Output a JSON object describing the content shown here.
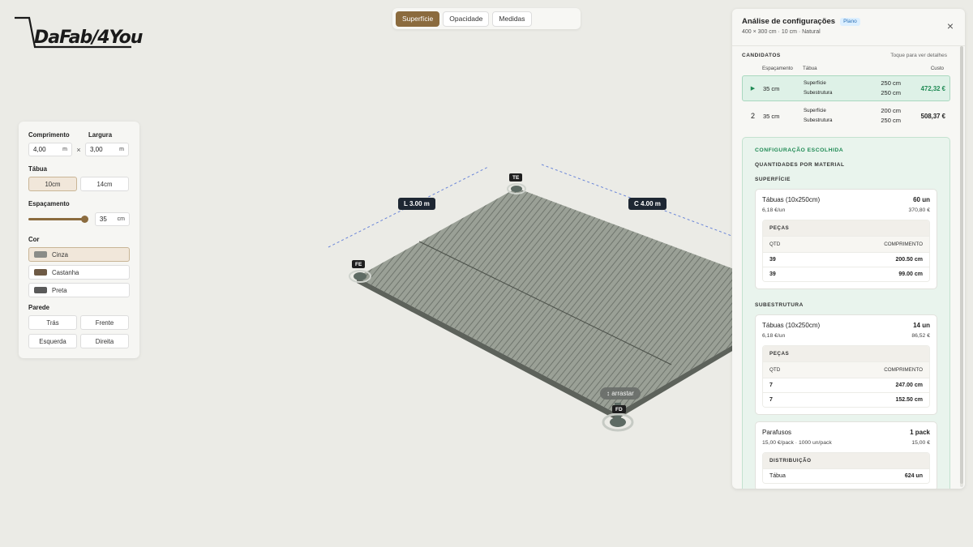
{
  "logo": {
    "text": "DaFab/4You"
  },
  "topbar": {
    "tabs": [
      "Superfície",
      "Opacidade",
      "Medidas"
    ],
    "active": "Superfície"
  },
  "left": {
    "length_label": "Comprimento",
    "length_value": "4,00",
    "length_unit": "m",
    "times": "×",
    "width_label": "Largura",
    "width_value": "3,00",
    "width_unit": "m",
    "board_label": "Tábua",
    "board_opt1": "10cm",
    "board_opt2": "14cm",
    "spacing_label": "Espaçamento",
    "spacing_value": "35",
    "spacing_unit": "cm",
    "color_label": "Cor",
    "colors": [
      {
        "name": "Cinza",
        "swatch": "#8a8c88"
      },
      {
        "name": "Castanha",
        "swatch": "#6e5a45"
      },
      {
        "name": "Preta",
        "swatch": "#5a5a5a"
      }
    ],
    "wall_label": "Parede",
    "walls": [
      "Trás",
      "Frente",
      "Esquerda",
      "Direita"
    ]
  },
  "viewport": {
    "corner_te": "TE",
    "corner_fe": "FE",
    "corner_fd": "FD",
    "dim_l": "L 3.00 m",
    "dim_c": "C 4.00 m",
    "drag": "↕ arrastar"
  },
  "right": {
    "title": "Análise de configurações",
    "badge": "Plano",
    "subtitle": "400 × 300 cm · 10 cm · Natural",
    "close": "×",
    "candidates_title": "CANDIDATOS",
    "candidates_hint": "Toque para ver detalhes",
    "col_spacing": "Espaçamento",
    "col_board": "Tábua",
    "col_cost": "Custo",
    "candidates": [
      {
        "rank": "▶",
        "spacing": "35 cm",
        "l1": "Superfície",
        "v1": "250 cm",
        "l2": "Subestrutura",
        "v2": "250 cm",
        "cost": "472,32 €"
      },
      {
        "rank": "2",
        "spacing": "35 cm",
        "l1": "Superfície",
        "v1": "200 cm",
        "l2": "Subestrutura",
        "v2": "250 cm",
        "cost": "508,37 €"
      }
    ],
    "chosen_title": "CONFIGURAÇÃO ESCOLHIDA",
    "qty_title": "QUANTIDADES POR MATERIAL",
    "surface": {
      "cap": "SUPERFÍCIE",
      "name": "Tábuas (10x250cm)",
      "qty": "60 un",
      "unit_price": "6,18 €/un",
      "total": "370,80 €",
      "pieces_cap": "PEÇAS",
      "col_qty": "QTD",
      "col_len": "COMPRIMENTO",
      "rows": [
        {
          "q": "39",
          "l": "200.50 cm"
        },
        {
          "q": "39",
          "l": "99.00 cm"
        }
      ]
    },
    "sub": {
      "cap": "SUBESTRUTURA",
      "name": "Tábuas (10x250cm)",
      "qty": "14 un",
      "unit_price": "6,18 €/un",
      "total": "86,52 €",
      "pieces_cap": "PEÇAS",
      "col_qty": "QTD",
      "col_len": "COMPRIMENTO",
      "rows": [
        {
          "q": "7",
          "l": "247.00 cm"
        },
        {
          "q": "7",
          "l": "152.50 cm"
        }
      ]
    },
    "screws": {
      "name": "Parafusos",
      "qty": "1 pack",
      "unit_price": "15,00 €/pack · 1000 un/pack",
      "total": "15,00 €",
      "dist_cap": "DISTRIBUIÇÃO",
      "row_label": "Tábua",
      "row_value": "624 un"
    }
  }
}
